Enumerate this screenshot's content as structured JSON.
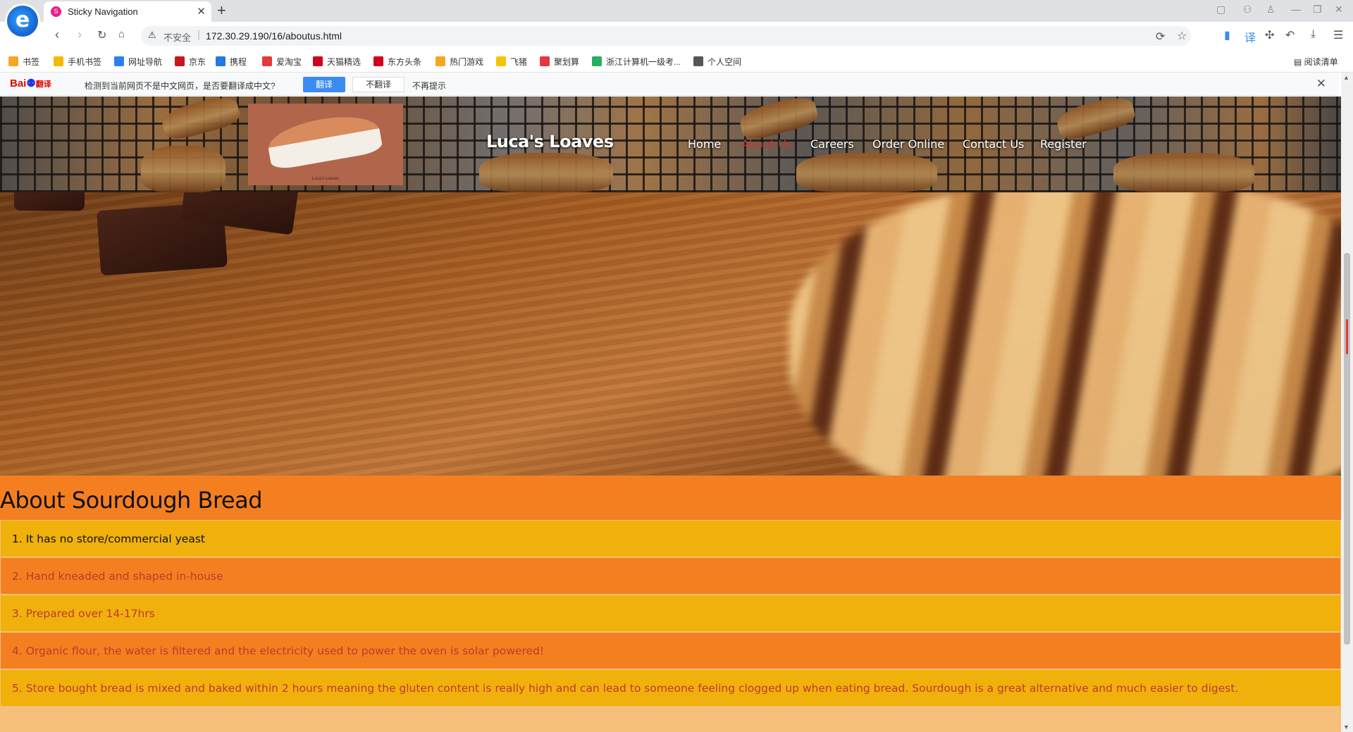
{
  "browser": {
    "logo": "e",
    "tab": {
      "title": "Sticky Navigation",
      "favicon": "S"
    },
    "new_tab": "+",
    "address": {
      "insecure_label": "不安全",
      "url": "172.30.29.190/16/aboutus.html"
    },
    "bookmarks": [
      {
        "label": "书签",
        "color": "#f5a623",
        "icon": "star-icon"
      },
      {
        "label": "手机书签",
        "color": "#f5b800",
        "icon": "bookmark-icon"
      },
      {
        "label": "网址导航",
        "color": "#2f80ed",
        "icon": "compass-icon"
      },
      {
        "label": "京东",
        "color": "#c8161d",
        "icon": "jd-icon"
      },
      {
        "label": "携程",
        "color": "#2577e3",
        "icon": "ctrip-icon"
      },
      {
        "label": "爱淘宝",
        "color": "#e4393c",
        "icon": "taobao-icon"
      },
      {
        "label": "天猫精选",
        "color": "#d0021b",
        "icon": "tmall-icon"
      },
      {
        "label": "东方头条",
        "color": "#d0021b",
        "icon": "news-icon"
      },
      {
        "label": "热门游戏",
        "color": "#f5a623",
        "icon": "game-icon"
      },
      {
        "label": "飞猪",
        "color": "#f5c400",
        "icon": "fliggy-icon"
      },
      {
        "label": "聚划算",
        "color": "#e4393c",
        "icon": "juhuasuan-icon"
      },
      {
        "label": "浙江计算机一级考...",
        "color": "#27ae60",
        "icon": "exam-icon"
      },
      {
        "label": "个人空间",
        "color": "#555555",
        "icon": "space-icon"
      }
    ],
    "reading_list": "阅读清单",
    "translate_bar": {
      "brand": "Bai翻译",
      "message": "检测到当前网页不是中文网页，是否要翻译成中文?",
      "translate": "翻译",
      "dont_translate": "不翻译",
      "never": "不再提示"
    }
  },
  "site": {
    "brand": "Luca's Loaves",
    "logo_caption": "Luca's Loaves",
    "nav": [
      {
        "label": "Home",
        "active": false
      },
      {
        "label": "About Us",
        "active": true
      },
      {
        "label": "Careers",
        "active": false
      },
      {
        "label": "Order Online",
        "active": false
      },
      {
        "label": "Contact Us",
        "active": false
      },
      {
        "label": "Register",
        "active": false
      }
    ],
    "colors": {
      "heading_bg": "#f47f20",
      "row_gold": "#f0b10c",
      "row_orange": "#f47f20",
      "active_link": "#c0392b"
    }
  },
  "about": {
    "title": "About Sourdough Bread",
    "facts": [
      "1. It has no store/commercial yeast",
      "2. Hand kneaded and shaped in-house",
      "3. Prepared over 14-17hrs",
      "4. Organic flour, the water is filtered and the electricity used to power the oven is solar powered!",
      "5. Store bought bread is mixed and baked within 2 hours meaning the gluten content is really high and can lead to someone feeling clogged up when eating bread. Sourdough is a great alternative and much easier to digest."
    ]
  }
}
